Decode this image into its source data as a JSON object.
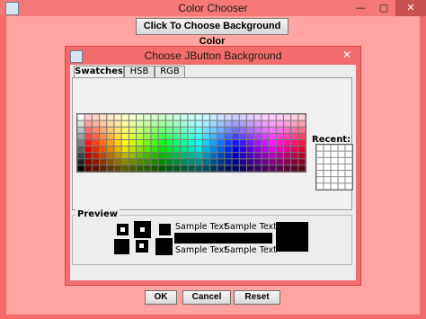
{
  "window": {
    "title": "Color Chooser",
    "minimize_glyph": "—",
    "maximize_glyph": "▢",
    "close_glyph": "✕",
    "icon": "java-cup-icon"
  },
  "toolbar": {
    "choose_button_label": "Click To Choose Background Color"
  },
  "dialog": {
    "title": "Choose JButton Background",
    "close_glyph": "✕",
    "icon": "java-cup-icon",
    "tabs": [
      {
        "label": "Swatches",
        "active": true
      },
      {
        "label": "HSB",
        "active": false
      },
      {
        "label": "RGB",
        "active": false
      }
    ],
    "recent_label": "Recent:",
    "preview_label": "Preview",
    "sample_texts": [
      "Sample Text",
      "Sample Text",
      "Sample Text",
      "Sample Text"
    ],
    "buttons": {
      "ok": "OK",
      "cancel": "Cancel",
      "reset": "Reset"
    }
  },
  "colors": {
    "window_background": "#ffa3a3",
    "title_bar": "#f47878",
    "selected_color": "#000000"
  }
}
